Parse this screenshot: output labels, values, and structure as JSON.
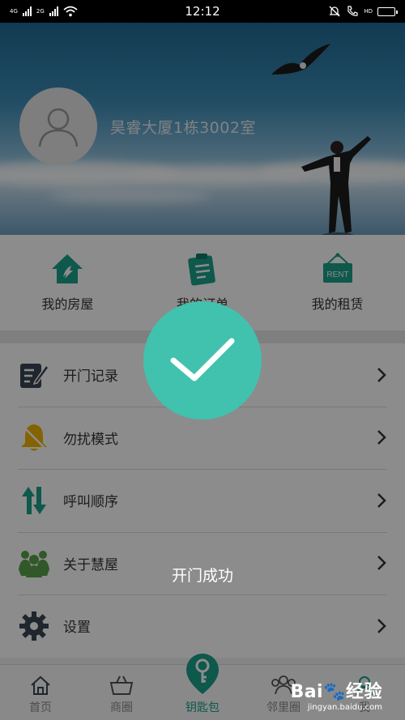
{
  "status_bar": {
    "time": "12:12",
    "net_1": "4G",
    "net_2": "2G",
    "net_3": "HD"
  },
  "header": {
    "house_name": "昊睿大厦1栋3002室"
  },
  "quick_actions": [
    {
      "label": "我的房屋",
      "icon": "house-icon"
    },
    {
      "label": "我的订单",
      "icon": "order-icon"
    },
    {
      "label": "我的租赁",
      "icon": "rent-sign-icon",
      "sign_text": "RENT"
    }
  ],
  "menu": [
    {
      "label": "开门记录",
      "icon": "edit-record-icon"
    },
    {
      "label": "勿扰模式",
      "icon": "bell-mute-icon"
    },
    {
      "label": "呼叫顺序",
      "icon": "sort-arrows-icon"
    },
    {
      "label": "关于慧屋",
      "icon": "people-group-icon"
    },
    {
      "label": "设置",
      "icon": "gear-icon"
    }
  ],
  "tabbar": [
    {
      "label": "首页",
      "icon": "home-icon"
    },
    {
      "label": "商圈",
      "icon": "basket-icon"
    },
    {
      "label": "钥匙包",
      "icon": "key-icon",
      "active": true
    },
    {
      "label": "邻里圈",
      "icon": "neighbors-icon"
    },
    {
      "label": "我",
      "icon": "profile-icon"
    }
  ],
  "overlay": {
    "message": "开门成功",
    "icon": "checkmark-icon"
  },
  "watermark": {
    "main": "Bai🐾经验",
    "sub": "jingyan.baidu.com"
  },
  "colors": {
    "accent": "#40c2ae",
    "icon_green": "#1aa08a",
    "bell_yellow": "#f0b400",
    "tab_active": "#1aa08a"
  }
}
